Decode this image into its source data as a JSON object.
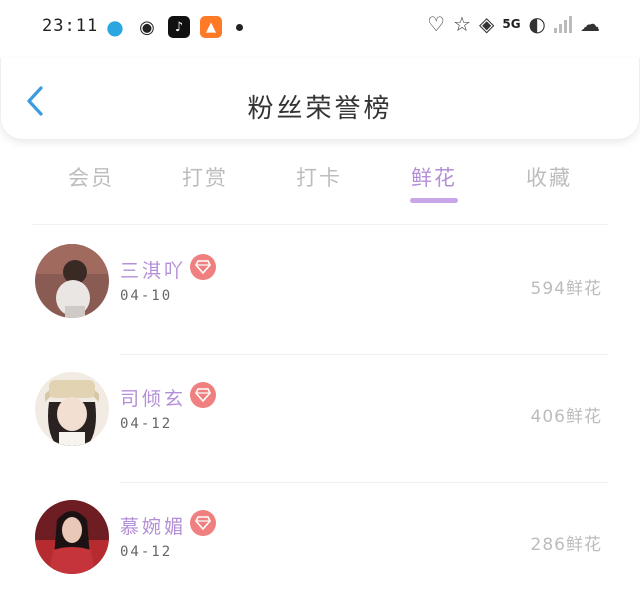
{
  "status_bar": {
    "time": "23:11",
    "network": "5G",
    "apps": [
      "qq-icon",
      "wechat-icon",
      "tiktok-icon",
      "orange-app-icon"
    ]
  },
  "header": {
    "back_icon": "chevron-left-icon",
    "title": "粉丝荣誉榜"
  },
  "tabs": [
    {
      "label": "会员",
      "active": false
    },
    {
      "label": "打赏",
      "active": false
    },
    {
      "label": "打卡",
      "active": false
    },
    {
      "label": "鲜花",
      "active": true
    },
    {
      "label": "收藏",
      "active": false
    }
  ],
  "colors": {
    "accent": "#b48fd8",
    "badge": "#f07f7f",
    "back": "#3a9be0"
  },
  "fans": [
    {
      "name": "三淇吖",
      "date": "04-10",
      "count": "594鲜花",
      "badge_icon": "diamond-icon"
    },
    {
      "name": "司倾玄",
      "date": "04-12",
      "count": "406鲜花",
      "badge_icon": "diamond-icon"
    },
    {
      "name": "慕婉媚",
      "date": "04-12",
      "count": "286鲜花",
      "badge_icon": "diamond-icon"
    }
  ]
}
